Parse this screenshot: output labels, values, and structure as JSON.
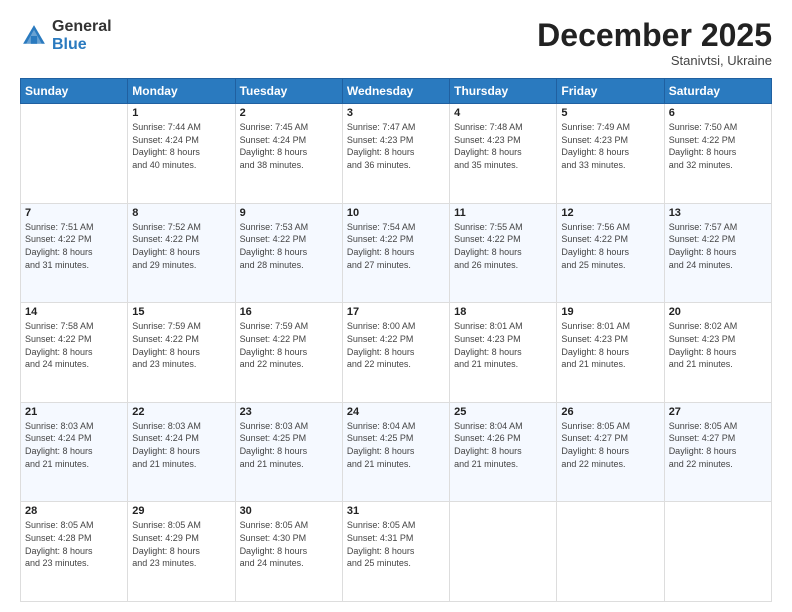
{
  "logo": {
    "general": "General",
    "blue": "Blue"
  },
  "header": {
    "month": "December 2025",
    "location": "Stanivtsi, Ukraine"
  },
  "weekdays": [
    "Sunday",
    "Monday",
    "Tuesday",
    "Wednesday",
    "Thursday",
    "Friday",
    "Saturday"
  ],
  "weeks": [
    [
      {
        "day": "",
        "info": ""
      },
      {
        "day": "1",
        "info": "Sunrise: 7:44 AM\nSunset: 4:24 PM\nDaylight: 8 hours\nand 40 minutes."
      },
      {
        "day": "2",
        "info": "Sunrise: 7:45 AM\nSunset: 4:24 PM\nDaylight: 8 hours\nand 38 minutes."
      },
      {
        "day": "3",
        "info": "Sunrise: 7:47 AM\nSunset: 4:23 PM\nDaylight: 8 hours\nand 36 minutes."
      },
      {
        "day": "4",
        "info": "Sunrise: 7:48 AM\nSunset: 4:23 PM\nDaylight: 8 hours\nand 35 minutes."
      },
      {
        "day": "5",
        "info": "Sunrise: 7:49 AM\nSunset: 4:23 PM\nDaylight: 8 hours\nand 33 minutes."
      },
      {
        "day": "6",
        "info": "Sunrise: 7:50 AM\nSunset: 4:22 PM\nDaylight: 8 hours\nand 32 minutes."
      }
    ],
    [
      {
        "day": "7",
        "info": "Sunrise: 7:51 AM\nSunset: 4:22 PM\nDaylight: 8 hours\nand 31 minutes."
      },
      {
        "day": "8",
        "info": "Sunrise: 7:52 AM\nSunset: 4:22 PM\nDaylight: 8 hours\nand 29 minutes."
      },
      {
        "day": "9",
        "info": "Sunrise: 7:53 AM\nSunset: 4:22 PM\nDaylight: 8 hours\nand 28 minutes."
      },
      {
        "day": "10",
        "info": "Sunrise: 7:54 AM\nSunset: 4:22 PM\nDaylight: 8 hours\nand 27 minutes."
      },
      {
        "day": "11",
        "info": "Sunrise: 7:55 AM\nSunset: 4:22 PM\nDaylight: 8 hours\nand 26 minutes."
      },
      {
        "day": "12",
        "info": "Sunrise: 7:56 AM\nSunset: 4:22 PM\nDaylight: 8 hours\nand 25 minutes."
      },
      {
        "day": "13",
        "info": "Sunrise: 7:57 AM\nSunset: 4:22 PM\nDaylight: 8 hours\nand 24 minutes."
      }
    ],
    [
      {
        "day": "14",
        "info": "Sunrise: 7:58 AM\nSunset: 4:22 PM\nDaylight: 8 hours\nand 24 minutes."
      },
      {
        "day": "15",
        "info": "Sunrise: 7:59 AM\nSunset: 4:22 PM\nDaylight: 8 hours\nand 23 minutes."
      },
      {
        "day": "16",
        "info": "Sunrise: 7:59 AM\nSunset: 4:22 PM\nDaylight: 8 hours\nand 22 minutes."
      },
      {
        "day": "17",
        "info": "Sunrise: 8:00 AM\nSunset: 4:22 PM\nDaylight: 8 hours\nand 22 minutes."
      },
      {
        "day": "18",
        "info": "Sunrise: 8:01 AM\nSunset: 4:23 PM\nDaylight: 8 hours\nand 21 minutes."
      },
      {
        "day": "19",
        "info": "Sunrise: 8:01 AM\nSunset: 4:23 PM\nDaylight: 8 hours\nand 21 minutes."
      },
      {
        "day": "20",
        "info": "Sunrise: 8:02 AM\nSunset: 4:23 PM\nDaylight: 8 hours\nand 21 minutes."
      }
    ],
    [
      {
        "day": "21",
        "info": "Sunrise: 8:03 AM\nSunset: 4:24 PM\nDaylight: 8 hours\nand 21 minutes."
      },
      {
        "day": "22",
        "info": "Sunrise: 8:03 AM\nSunset: 4:24 PM\nDaylight: 8 hours\nand 21 minutes."
      },
      {
        "day": "23",
        "info": "Sunrise: 8:03 AM\nSunset: 4:25 PM\nDaylight: 8 hours\nand 21 minutes."
      },
      {
        "day": "24",
        "info": "Sunrise: 8:04 AM\nSunset: 4:25 PM\nDaylight: 8 hours\nand 21 minutes."
      },
      {
        "day": "25",
        "info": "Sunrise: 8:04 AM\nSunset: 4:26 PM\nDaylight: 8 hours\nand 21 minutes."
      },
      {
        "day": "26",
        "info": "Sunrise: 8:05 AM\nSunset: 4:27 PM\nDaylight: 8 hours\nand 22 minutes."
      },
      {
        "day": "27",
        "info": "Sunrise: 8:05 AM\nSunset: 4:27 PM\nDaylight: 8 hours\nand 22 minutes."
      }
    ],
    [
      {
        "day": "28",
        "info": "Sunrise: 8:05 AM\nSunset: 4:28 PM\nDaylight: 8 hours\nand 23 minutes."
      },
      {
        "day": "29",
        "info": "Sunrise: 8:05 AM\nSunset: 4:29 PM\nDaylight: 8 hours\nand 23 minutes."
      },
      {
        "day": "30",
        "info": "Sunrise: 8:05 AM\nSunset: 4:30 PM\nDaylight: 8 hours\nand 24 minutes."
      },
      {
        "day": "31",
        "info": "Sunrise: 8:05 AM\nSunset: 4:31 PM\nDaylight: 8 hours\nand 25 minutes."
      },
      {
        "day": "",
        "info": ""
      },
      {
        "day": "",
        "info": ""
      },
      {
        "day": "",
        "info": ""
      }
    ]
  ]
}
